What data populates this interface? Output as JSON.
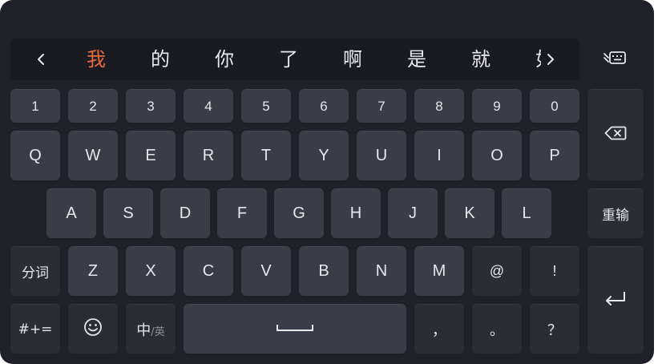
{
  "candidates": {
    "words": [
      "我",
      "的",
      "你",
      "了",
      "啊",
      "是",
      "就",
      "如"
    ],
    "selected_index": 0,
    "selected_color": "#e96a3c"
  },
  "rows": {
    "numbers": [
      "1",
      "2",
      "3",
      "4",
      "5",
      "6",
      "7",
      "8",
      "9",
      "0"
    ],
    "qwerty": [
      "Q",
      "W",
      "E",
      "R",
      "T",
      "Y",
      "U",
      "I",
      "O",
      "P"
    ],
    "asdf": [
      "A",
      "S",
      "D",
      "F",
      "G",
      "H",
      "J",
      "K",
      "L"
    ],
    "zxcv": [
      "Z",
      "X",
      "C",
      "V",
      "B",
      "N",
      "M",
      "@",
      "!"
    ]
  },
  "keys": {
    "fenci": "分词",
    "chongshu": "重输",
    "symbols": "#+=",
    "zhong": "中",
    "ying": "/英",
    "comma": "，",
    "period": "。",
    "question": "？"
  },
  "icons": {
    "prev": "chevron-left-icon",
    "next": "chevron-right-icon",
    "hide": "keyboard-hide-icon",
    "backspace": "backspace-icon",
    "enter": "enter-icon",
    "emoji": "smiley-icon",
    "space": "space-bar-icon"
  },
  "colors": {
    "keyboard_bg": "#1f2029",
    "key": "#3a3c4a",
    "key_function": "#2b2c38",
    "text": "#e6e7ec"
  }
}
